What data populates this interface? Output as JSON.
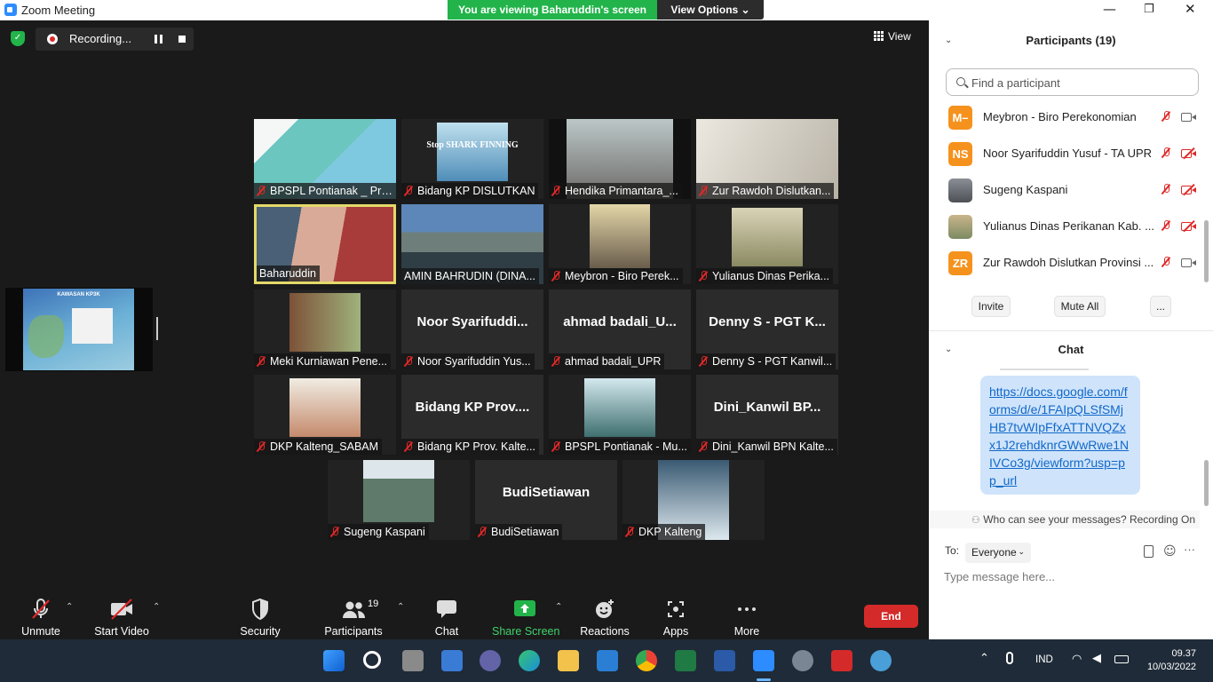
{
  "window": {
    "title": "Zoom Meeting"
  },
  "banner": {
    "viewing": "You are viewing Baharuddin's screen",
    "view_options": "View Options ⌄"
  },
  "recording": {
    "label": "Recording..."
  },
  "view_button": {
    "label": "View"
  },
  "share_slide": {
    "title": "KAWASAN KP3K"
  },
  "gallery": [
    {
      "name": "BPSPL Pontianak _ Pri...",
      "big": "",
      "muted": true
    },
    {
      "name": "Bidang KP DISLUTKAN",
      "big": "",
      "muted": true
    },
    {
      "name": "Hendika Primantara_...",
      "big": "",
      "muted": true
    },
    {
      "name": "Zur Rawdoh Dislutkan...",
      "big": "",
      "muted": true
    },
    {
      "name": "Baharuddin",
      "big": "",
      "muted": false
    },
    {
      "name": "AMIN BAHRUDIN (DINA...",
      "big": "",
      "muted": false
    },
    {
      "name": "Meybron - Biro Perek...",
      "big": "",
      "muted": true
    },
    {
      "name": "Yulianus Dinas Perika...",
      "big": "",
      "muted": true
    },
    {
      "name": "Meki Kurniawan Pene...",
      "big": "",
      "muted": true
    },
    {
      "name": "Noor Syarifuddin Yus...",
      "big": "Noor  Syarifuddi...",
      "muted": true
    },
    {
      "name": "ahmad badali_UPR",
      "big": "ahmad  badali_U...",
      "muted": true
    },
    {
      "name": "Denny S - PGT Kanwil...",
      "big": "Denny S - PGT K...",
      "muted": true
    },
    {
      "name": "DKP Kalteng_SABAM",
      "big": "",
      "muted": true
    },
    {
      "name": "Bidang KP Prov. Kalte...",
      "big": "Bidang  KP  Prov....",
      "muted": true
    },
    {
      "name": "BPSPL Pontianak - Mu...",
      "big": "",
      "muted": true
    },
    {
      "name": "Dini_Kanwil BPN Kalte...",
      "big": "Dini_Kanwil  BP...",
      "muted": true
    },
    {
      "name": "Sugeng Kaspani",
      "big": "",
      "muted": true
    },
    {
      "name": "BudiSetiawan",
      "big": "BudiSetiawan",
      "muted": true
    },
    {
      "name": "DKP Kalteng",
      "big": "",
      "muted": true
    }
  ],
  "tile_texts": {
    "stop_shark": "Stop SHARK FINNING"
  },
  "toolbar": {
    "unmute": "Unmute",
    "start_video": "Start Video",
    "security": "Security",
    "participants": "Participants",
    "participants_count": "19",
    "chat": "Chat",
    "share_screen": "Share Screen",
    "reactions": "Reactions",
    "apps": "Apps",
    "more": "More",
    "end": "End"
  },
  "panel": {
    "participants_title": "Participants (19)",
    "search_placeholder": "Find a participant",
    "participants": [
      {
        "initials": "M–",
        "name": "Meybron - Biro Perekonomian",
        "cam_off": false
      },
      {
        "initials": "NS",
        "name": "Noor Syarifuddin Yusuf - TA UPR",
        "cam_off": true
      },
      {
        "initials": "",
        "name": "Sugeng Kaspani",
        "cam_off": true
      },
      {
        "initials": "",
        "name": "Yulianus Dinas Perikanan Kab. ...",
        "cam_off": true
      },
      {
        "initials": "ZR",
        "name": "Zur Rawdoh Dislutkan Provinsi ...",
        "cam_off": false
      }
    ],
    "invite": "Invite",
    "mute_all": "Mute All",
    "more": "...",
    "chat_title": "Chat",
    "chat_message": "https://docs.google.com/forms/d/e/1FAIpQLSfSMjHB7tvWIpFfxATTNVQZxx1J2rehdknrGWwRwe1NIVCo3g/viewform?usp=pp_url",
    "who_can_see": "Who can see your messages? Recording On",
    "to_label": "To:",
    "to_value": "Everyone",
    "type_placeholder": "Type message here..."
  },
  "taskbar": {
    "lang": "IND",
    "time": "09.37",
    "date": "10/03/2022"
  },
  "colors": {
    "accent": "#2d8cff",
    "end": "#d42a2a",
    "share": "#22b44a",
    "avatar": "#f5921e",
    "muted": "#e02828"
  }
}
